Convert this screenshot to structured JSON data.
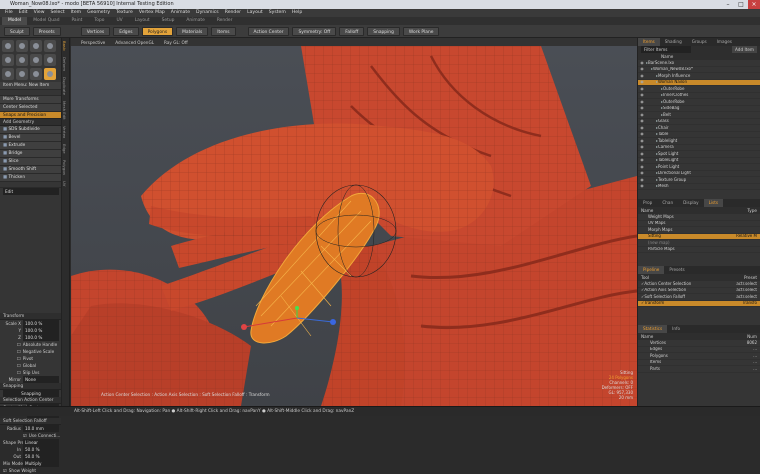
{
  "window": {
    "title": "Woman_Now08.lxo* - modo [BETA 56910] Internal Testing Edition"
  },
  "menu": [
    "File",
    "Edit",
    "View",
    "Select",
    "Item",
    "Geometry",
    "Texture",
    "Vertex Map",
    "Animate",
    "Dynamics",
    "Render",
    "Layout",
    "System",
    "Help"
  ],
  "layout_tabs": [
    {
      "label": "Model",
      "active": true
    },
    {
      "label": "Model Quad",
      "active": false
    },
    {
      "label": "Paint",
      "active": false
    },
    {
      "label": "Topo",
      "active": false
    },
    {
      "label": "UV",
      "active": false
    },
    {
      "label": "Layout",
      "active": false
    },
    {
      "label": "Setup",
      "active": false
    },
    {
      "label": "Animate",
      "active": false
    },
    {
      "label": "Render",
      "active": false
    }
  ],
  "toolbar": {
    "sculpt": "Sculpt",
    "presets": "Presets",
    "vertices": "Vertices",
    "edges": "Edges",
    "polygons": "Polygons",
    "materials": "Materials",
    "items": "Items",
    "action_center": "Action Center",
    "symmetry": "Symmetry: Off",
    "falloff": "Falloff",
    "snapping": "Snapping",
    "work_plane": "Work Plane"
  },
  "left_panel": {
    "item_menu": "Item Menu: New Item",
    "more_transforms": "More Transforms",
    "center_selected": "Center Selected",
    "snaps_precision": "Snaps and Precision",
    "add_geometry": "Add Geometry",
    "tools": [
      "SDS Subdivide",
      "Bevel",
      "Extrude",
      "Bridge",
      "Slice",
      "Smooth Shift",
      "Thicken"
    ],
    "edit_select": "Edit",
    "transform_hdr": "Transform",
    "scale_x_label": "Scale X",
    "scale_x": "100.0 %",
    "y_label": "Y",
    "scale_y": "100.0 %",
    "z_label": "Z",
    "scale_z": "100.0 %",
    "opts": [
      "Absolute Handle",
      "Negative Scale",
      "Pivot",
      "Global",
      "Slip Uvs"
    ],
    "mirror_label": "Mirror",
    "mirror_val": "None",
    "snapping_hdr": "Snapping",
    "snapping_val": "Snapping",
    "sel_action_center": "Selection Action Center",
    "center_mode_label": "Center Mode",
    "center_mode": "Center",
    "axis_label": "Axis",
    "axis_val": "Auto",
    "soft_falloff": "Soft Selection Falloff",
    "radius_label": "Radius",
    "radius": "10.0 mm",
    "use_connect": "Use Connecti...",
    "shape_preset_label": "Shape Pre...",
    "shape_preset": "Linear",
    "ease_in_label": "In",
    "ease_in": "50.0 %",
    "ease_out_label": "Out",
    "ease_out": "50.0 %",
    "mix_mode_label": "Mix Mode",
    "mix_mode": "Multiply",
    "show_weight": "Show Weight"
  },
  "side_tabs": [
    "Basic",
    "Deform",
    "Duplicate",
    "Mesh Edit",
    "Vertex",
    "Edge",
    "Polygon",
    "UV"
  ],
  "viewport": {
    "tabs": [
      "Perspective",
      "Advanced OpenGL",
      "Ray GL: Off"
    ],
    "status_lines": [
      "Sitting",
      "24 Polygons",
      "Channels: 0",
      "Deformers: OFF",
      "GL: 957,330",
      "20 mm"
    ],
    "footer": "Action Center Selection : Action Axis Selection : Soft Selection Falloff : Transform"
  },
  "right_panel": {
    "tabs": [
      "Items",
      "Shading",
      "Groups",
      "Images"
    ],
    "filter_label": "Filter Items",
    "add_item": "Add Item",
    "name_col": "Name",
    "items": [
      {
        "label": "BarScene.lxo",
        "indent": 0,
        "sel": false
      },
      {
        "label": "Woman_New08.lxo*",
        "indent": 1,
        "sel": false
      },
      {
        "label": "Morph Influence",
        "indent": 2,
        "sel": false
      },
      {
        "label": "Woman Nailon",
        "indent": 2,
        "sel": true
      },
      {
        "label": "OuterRobe",
        "indent": 3,
        "sel": false
      },
      {
        "label": "InnerClothes",
        "indent": 3,
        "sel": false
      },
      {
        "label": "OuterRobe",
        "indent": 3,
        "sel": false
      },
      {
        "label": "SideBag",
        "indent": 3,
        "sel": false
      },
      {
        "label": "Belt",
        "indent": 3,
        "sel": false
      },
      {
        "label": "Glass",
        "indent": 2,
        "sel": false
      },
      {
        "label": "Chair",
        "indent": 2,
        "sel": false
      },
      {
        "label": "Table",
        "indent": 2,
        "sel": false
      },
      {
        "label": "Tablelight",
        "indent": 2,
        "sel": false
      },
      {
        "label": "Camera",
        "indent": 2,
        "sel": false
      },
      {
        "label": "Spot Light",
        "indent": 2,
        "sel": false
      },
      {
        "label": "TableLight",
        "indent": 2,
        "sel": false
      },
      {
        "label": "Point Light",
        "indent": 2,
        "sel": false
      },
      {
        "label": "Directional Light",
        "indent": 2,
        "sel": false
      },
      {
        "label": "Texture Group",
        "indent": 2,
        "sel": false
      },
      {
        "label": "Mesh",
        "indent": 2,
        "sel": false
      }
    ],
    "lists_tabs": [
      "Prop",
      "Chan",
      "Display",
      "Lists"
    ],
    "lists_cols": [
      "Name",
      "Type"
    ],
    "lists": [
      {
        "label": "Weight Maps",
        "type": ""
      },
      {
        "label": "UV Maps",
        "type": ""
      },
      {
        "label": "Morph Maps",
        "type": ""
      },
      {
        "label": "Sitting",
        "type": "Relative M",
        "sel": true
      },
      {
        "label": "(new map)",
        "type": "",
        "dim": true
      },
      {
        "label": "Particle Maps",
        "type": ""
      }
    ],
    "pipeline_tabs": [
      "Pipeline",
      "Presets"
    ],
    "pipeline_cols": [
      "Tool",
      "Preset"
    ],
    "pipeline": [
      {
        "label": "Action Center Selection",
        "preset": "actr.select",
        "sel": false
      },
      {
        "label": "Action Axis Selection",
        "preset": "actr.select",
        "sel": false
      },
      {
        "label": "Soft Selection Falloff",
        "preset": "actr.select",
        "sel": false
      },
      {
        "label": "Transform",
        "preset": "Transfo",
        "sel": true
      }
    ],
    "stats_tabs": [
      "Statistics",
      "Info"
    ],
    "stats_cols": [
      "Name",
      "Num"
    ],
    "stats": [
      {
        "label": "Vertices",
        "num": "8062"
      },
      {
        "label": "Edges",
        "num": "..."
      },
      {
        "label": "Polygons",
        "num": "..."
      },
      {
        "label": "Items",
        "num": "..."
      },
      {
        "label": "Parts",
        "num": "..."
      }
    ]
  },
  "statusbar": "Alt-Shift-Left Click and Drag: Navigation: Pan  ●  Alt-Shift-Right Click and Drag: navPanY  ●  Alt-Shift-Middle Click and Drag: navPanZ"
}
